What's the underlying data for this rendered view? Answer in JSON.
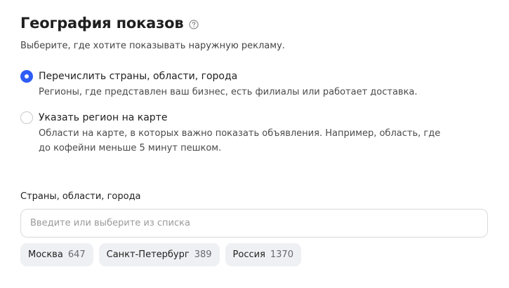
{
  "header": {
    "title": "География показов",
    "subtitle": "Выберите, где хотите показывать наружную рекламу."
  },
  "icons": {
    "help": "question-circle-icon"
  },
  "colors": {
    "accent": "#2e5cf5",
    "chip_background": "#eef0f3"
  },
  "options": [
    {
      "label": "Перечислить страны, области, города",
      "description": "Регионы, где представлен ваш бизнес, есть филиалы или работает доставка.",
      "checked": true
    },
    {
      "label": "Указать регион на карте",
      "description": "Области на карте, в которых важно показать объявления. Например, область, где до кофейни меньше 5 минут пешком.",
      "checked": false
    }
  ],
  "regions_field": {
    "label": "Страны, области, города",
    "placeholder": "Введите или выберите из списка",
    "value": ""
  },
  "suggestions": [
    {
      "name": "Москва",
      "count": "647"
    },
    {
      "name": "Санкт-Петербург",
      "count": "389"
    },
    {
      "name": "Россия",
      "count": "1370"
    }
  ]
}
